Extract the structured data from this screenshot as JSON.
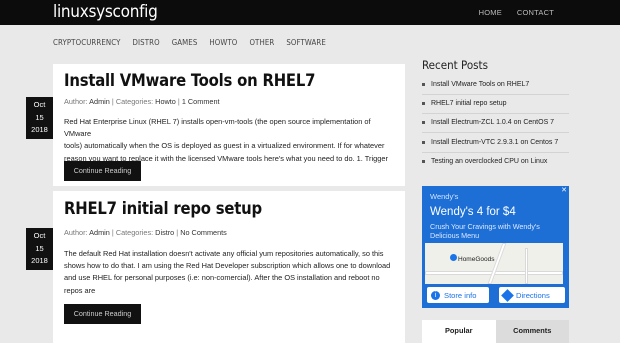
{
  "site": {
    "logo": "linuxsysconfig"
  },
  "top_links": [
    "HOME",
    "CONTACT"
  ],
  "categories": [
    "CRYPTOCURRENCY",
    "DISTRO",
    "GAMES",
    "HOWTO",
    "OTHER",
    "SOFTWARE"
  ],
  "posts": [
    {
      "date": [
        "Oct",
        "15",
        "2018"
      ],
      "title": "Install VMware Tools on RHEL7",
      "author_label": "Author:",
      "author": "Admin",
      "cat_label": "Categories:",
      "category": "Howto",
      "comments": "1 Comment",
      "body": [
        "Red Hat Enterprise Linux (RHEL 7) installs open-vm-tools (the open source implementation of VMware",
        "tools) automatically when the OS is deployed as guest in a virtualized environment. If for whatever",
        "reason you want to replace it with the licensed VMware tools here's what you need to do. 1. Trigger"
      ],
      "button": "Continue Reading"
    },
    {
      "date": [
        "Oct",
        "15",
        "2018"
      ],
      "title": "RHEL7 initial repo setup",
      "author_label": "Author:",
      "author": "Admin",
      "cat_label": "Categories:",
      "category": "Distro",
      "comments": "No Comments",
      "body": [
        "The default Red Hat installation doesn't activate any official yum repositories automatically, so this",
        "shows how to do that. I am using the Red Hat Developer subscription which allows one to download",
        "and use RHEL for personal purposes (i.e: non-comercial). After the OS installation and reboot no",
        "repos are"
      ],
      "button": "Continue Reading"
    }
  ],
  "sidebar": {
    "recent_title": "Recent Posts",
    "recent": [
      "Install VMware Tools on RHEL7",
      "RHEL7 initial repo setup",
      "Install Electrum-ZCL 1.0.4 on CentOS 7",
      "Install Electrum-VTC 2.9.3.1 on Centos 7",
      "Testing an overclocked CPU on Linux"
    ],
    "ad": {
      "brand": "Wendy's",
      "headline": "Wendy's 4 for $4",
      "sub": "Crush Your Cravings with Wendy's Delicious Menu",
      "map_label": "HomeGoods",
      "store_info": "Store info",
      "directions": "Directions"
    },
    "tabs": [
      "Popular",
      "Comments"
    ]
  },
  "colors": {
    "topbar": "#0c0c0c",
    "background": "#e9e9e9",
    "ad_blue": "#1d6fd6"
  }
}
